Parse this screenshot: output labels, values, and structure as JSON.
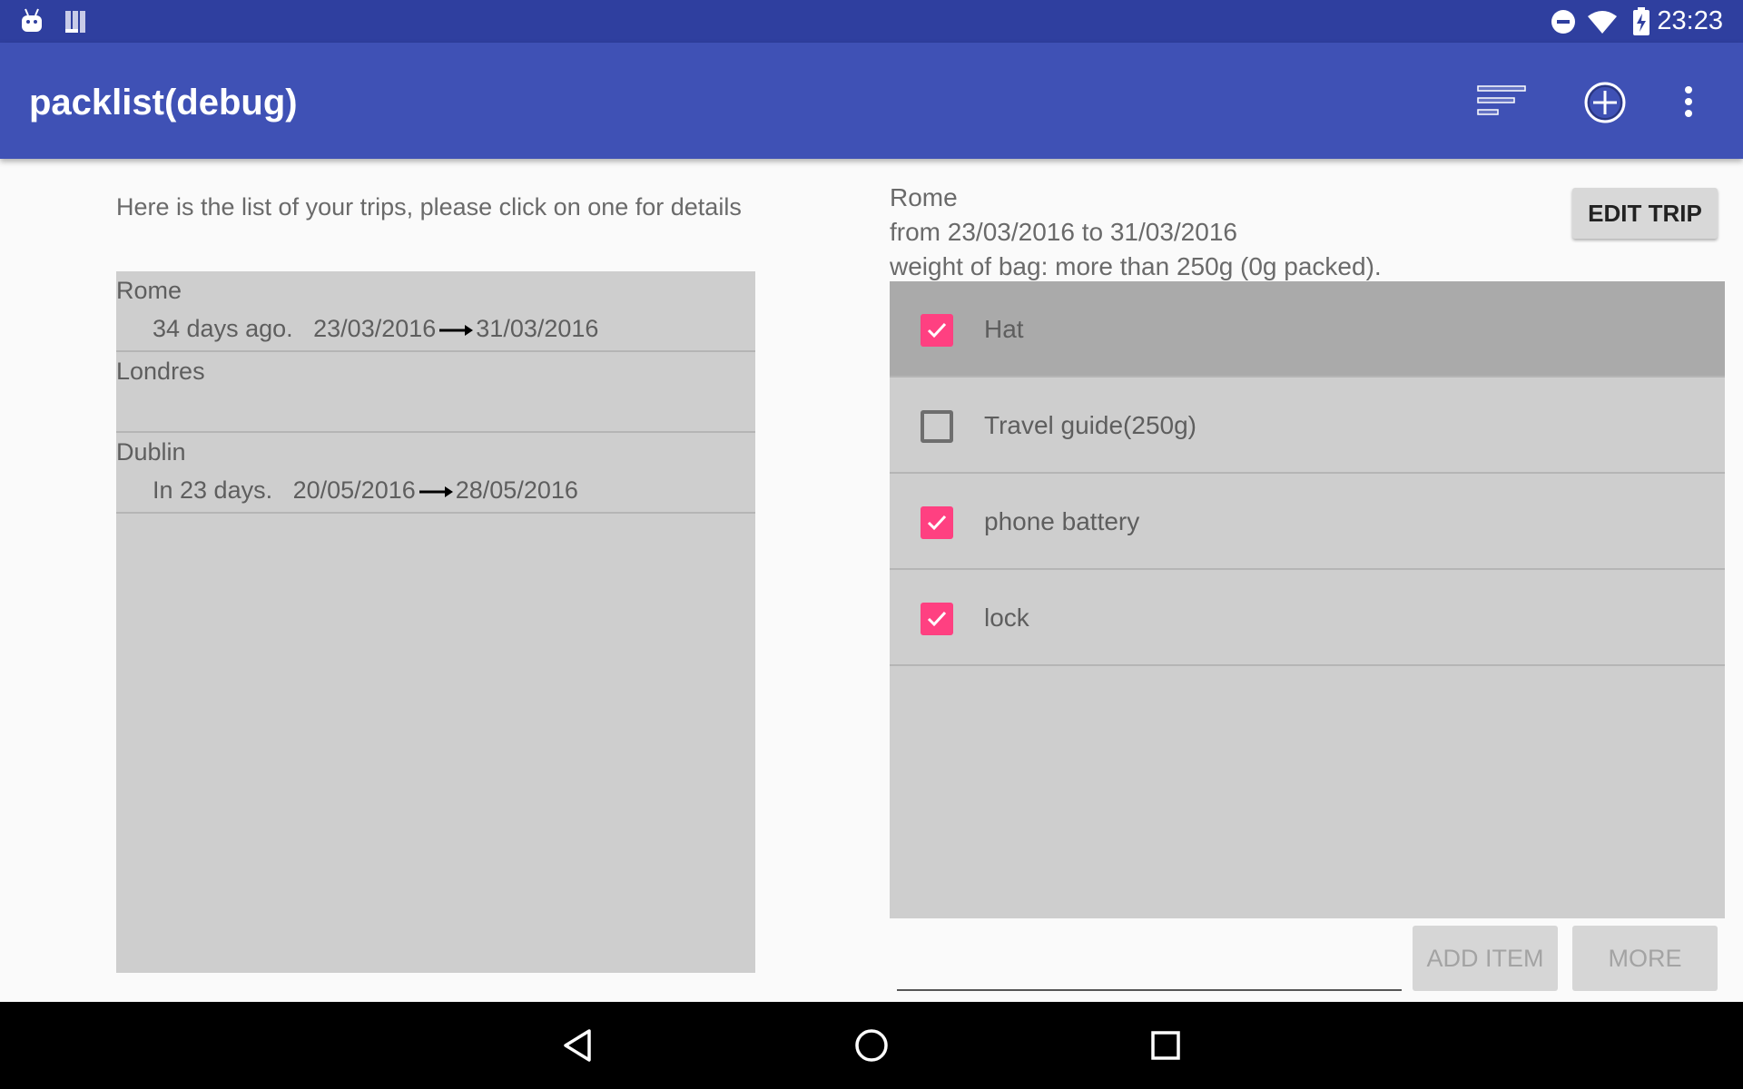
{
  "status_bar": {
    "time": "23:23",
    "icons": [
      "android-debug-icon",
      "sim-storage-icon",
      "do-not-disturb-icon",
      "wifi-icon",
      "battery-charging-icon"
    ]
  },
  "app_bar": {
    "title": "packlist(debug)",
    "actions": [
      "sort-icon",
      "add-circle-icon",
      "overflow-menu-icon"
    ]
  },
  "trips_panel": {
    "intro": "Here is the list of your trips, please click on one for details",
    "trips": [
      {
        "name": "Rome",
        "relative": "34 days ago.",
        "start": "23/03/2016",
        "end": "31/03/2016"
      },
      {
        "name": "Londres",
        "relative": "",
        "start": "",
        "end": ""
      },
      {
        "name": "Dublin",
        "relative": "In 23 days.",
        "start": "20/05/2016",
        "end": "28/05/2016"
      }
    ]
  },
  "trip_detail": {
    "name": "Rome",
    "dates_line": "from 23/03/2016 to 31/03/2016",
    "weight_line": "weight of bag: more than 250g (0g packed).",
    "edit_label": "EDIT TRIP",
    "items": [
      {
        "label": "Hat",
        "checked": true
      },
      {
        "label": "Travel guide(250g)",
        "checked": false
      },
      {
        "label": "phone battery",
        "checked": true
      },
      {
        "label": "lock",
        "checked": true
      }
    ],
    "new_item_value": "",
    "add_item_label": "ADD ITEM",
    "more_label": "MORE"
  },
  "colors": {
    "status_bar": "#2f3f9f",
    "app_bar": "#3f51b5",
    "checkbox_accent": "#ff4081",
    "list_background": "#cecece"
  },
  "nav_bar": [
    "back-icon",
    "home-icon",
    "recents-icon"
  ]
}
